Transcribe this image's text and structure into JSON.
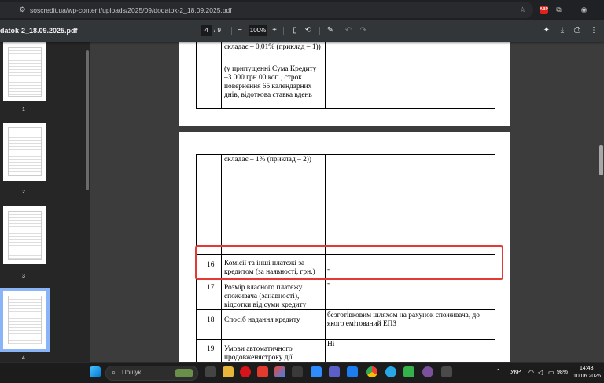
{
  "browser": {
    "url": "soscredit.ua/wp-content/uploads/2025/09/dodatok-2_18.09.2025.pdf",
    "abp_label": "ABP"
  },
  "pdf_toolbar": {
    "title": "datok-2_18.09.2025.pdf",
    "page_current": "4",
    "page_total": "/ 9",
    "zoom": "100%"
  },
  "thumbnails": [
    {
      "label": "1"
    },
    {
      "label": "2"
    },
    {
      "label": "3"
    },
    {
      "label": "4"
    }
  ],
  "page_prev": {
    "text1": "складає – 0,01% (приклад – 1))",
    "text2": "(у припущенні Сума Кредиту –3 000 грн.00 коп., строк повернення 65 календарних днів, відоткова ставка вдень"
  },
  "page_current": {
    "cont_text": "складає – 1% (приклад – 2))",
    "rows": [
      {
        "num": "16",
        "label": "Комісії та інші платежі за кредитом (за наявності, грн.)",
        "value": "-"
      },
      {
        "num": "17",
        "label": "Розмір власного платежу споживача (занавності), відсотки від суми кредиту",
        "value": "-"
      },
      {
        "num": "18",
        "label": "Спосіб надання кредиту",
        "value": "безготівковим шляхом на рахунок споживача, до якого емітований ЕПЗ"
      },
      {
        "num": "19",
        "label": "Умови автоматичного продовженястроку дії",
        "value": "Ні"
      }
    ]
  },
  "taskbar": {
    "search_placeholder": "Пошук",
    "lang": "УКР",
    "battery": "98%",
    "time": "14:43",
    "date": "10.06.2026"
  }
}
